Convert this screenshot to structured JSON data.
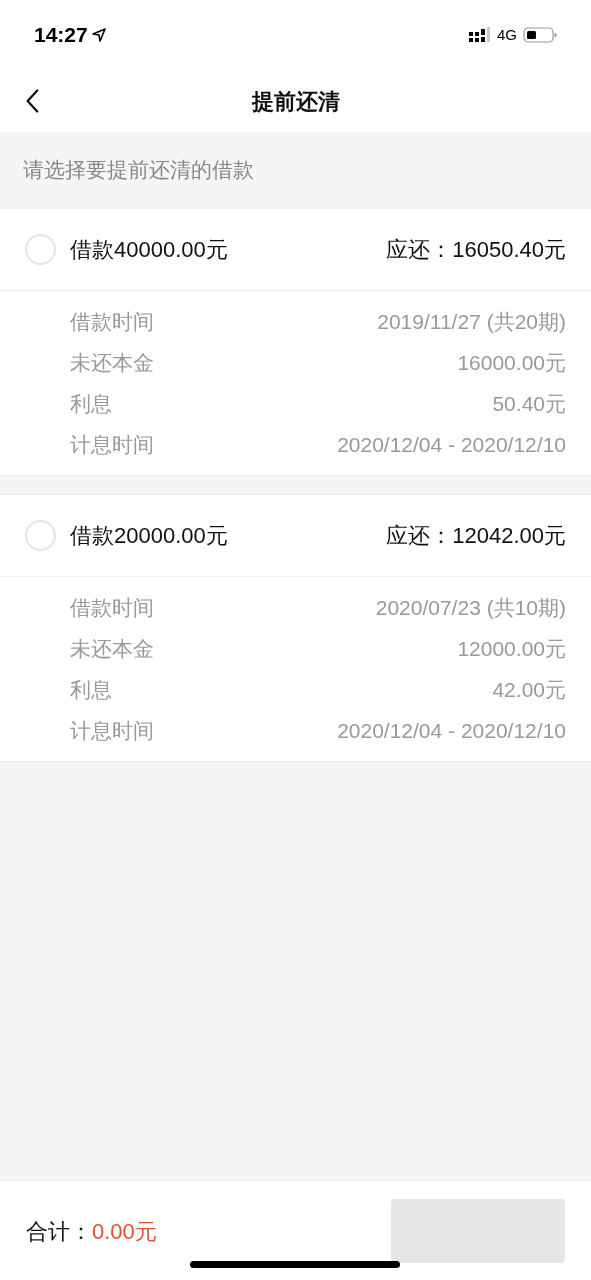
{
  "status_bar": {
    "time": "14:27",
    "network": "4G"
  },
  "nav": {
    "title": "提前还清"
  },
  "section_hint": "请选择要提前还清的借款",
  "loans": [
    {
      "title": "借款40000.00元",
      "due_label": "应还：",
      "due": "16050.40元",
      "selected": false,
      "details": [
        {
          "label": "借款时间",
          "value": "2019/11/27 (共20期)"
        },
        {
          "label": "未还本金",
          "value": "16000.00元"
        },
        {
          "label": "利息",
          "value": "50.40元"
        },
        {
          "label": "计息时间",
          "value": "2020/12/04 - 2020/12/10"
        }
      ]
    },
    {
      "title": "借款20000.00元",
      "due_label": "应还：",
      "due": "12042.00元",
      "selected": false,
      "details": [
        {
          "label": "借款时间",
          "value": "2020/07/23 (共10期)"
        },
        {
          "label": "未还本金",
          "value": "12000.00元"
        },
        {
          "label": "利息",
          "value": "42.00元"
        },
        {
          "label": "计息时间",
          "value": "2020/12/04 - 2020/12/10"
        }
      ]
    }
  ],
  "footer": {
    "total_label": "合计：",
    "total": "0.00元",
    "submit": {
      "disabled": true
    }
  }
}
